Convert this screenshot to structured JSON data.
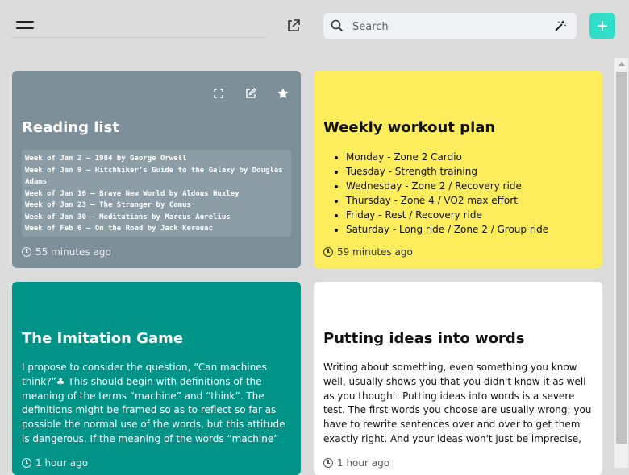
{
  "toolbar": {
    "search_placeholder": "Search"
  },
  "notes": [
    {
      "title": "Reading list",
      "time": "55 minutes ago",
      "lines": [
        "Week of Jan 2 – 1984 by George Orwell",
        "Week of Jan 9 – Hitchhiker’s Guide to the Galaxy by Douglas Adams",
        "Week of Jan 16 – Brave New World by Aldous Huxley",
        "Week of Jan 23 – The Stranger by Camus",
        "Week of Jan 30 – Meditations by Marcus Aurelius",
        "Week of Feb 6 – On the Road by Jack Kerouac"
      ],
      "color": "#7d9099"
    },
    {
      "title": "Weekly workout plan",
      "time": "59 minutes ago",
      "items": [
        "Monday - Zone 2 Cardio",
        "Tuesday - Strength training",
        "Wednesday - Zone 2 / Recovery ride",
        "Thursday - Zone 4 / VO2 max effort",
        "Friday - Rest / Recovery ride",
        "Saturday - Long ride / Zone 2 / Group ride"
      ],
      "color": "#fdec5c"
    },
    {
      "title": "The Imitation Game",
      "time": "1 hour ago",
      "text": "I propose to consider the question, “Can machines think?”♣ This should begin with definitions of the meaning of the terms “machine” and “think”. The definitions might be framed so as to reflect so far as possible the normal use of the words, but this attitude is dangerous. If the meaning of the words “machine” and “think” are to be found by examining how they",
      "color": "#009488"
    },
    {
      "title": "Putting ideas into words",
      "time": "1 hour ago",
      "text": "Writing about something, even something you know well, usually shows you that you didn't know it as well as you thought. Putting ideas into words is a severe test. The first words you choose are usually wrong; you have to rewrite sentences over and over to get them exactly right. And your ideas won't just be imprecise, but incomplete too. Half the",
      "color": "#ffffff"
    }
  ],
  "icons": {
    "menu": "hamburger-icon",
    "open": "external-link-icon",
    "search": "search-icon",
    "magic": "magic-wand-icon",
    "add": "plus-icon",
    "expand": "expand-icon",
    "edit": "edit-icon",
    "favorite": "star-icon",
    "clock": "clock-icon"
  },
  "accent": "#2fdfc9"
}
